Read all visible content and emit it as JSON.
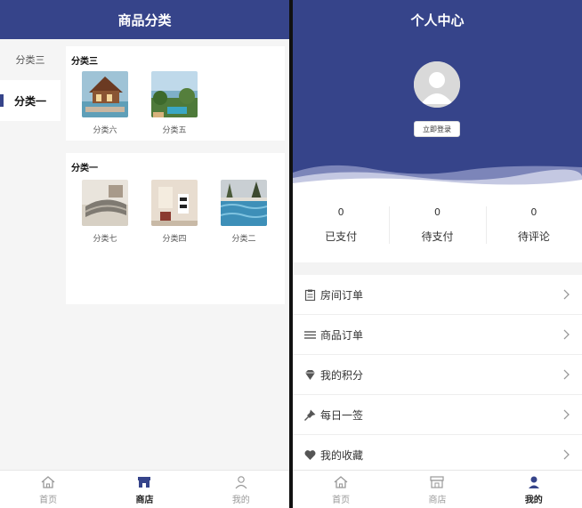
{
  "left": {
    "title": "商品分类",
    "categories": [
      {
        "label": "分类三",
        "active": false
      },
      {
        "label": "分类一",
        "active": true
      }
    ],
    "sections": [
      {
        "title": "分类三",
        "products": [
          {
            "label": "分类六"
          },
          {
            "label": "分类五"
          }
        ]
      },
      {
        "title": "分类一",
        "products": [
          {
            "label": "分类七"
          },
          {
            "label": "分类四"
          },
          {
            "label": "分类二"
          }
        ]
      }
    ],
    "tabs": [
      {
        "label": "首页",
        "icon": "home-icon",
        "active": false
      },
      {
        "label": "商店",
        "icon": "store-icon",
        "active": true
      },
      {
        "label": "我的",
        "icon": "user-icon",
        "active": false
      }
    ]
  },
  "right": {
    "title": "个人中心",
    "login_label": "立即登录",
    "stats": [
      {
        "value": "0",
        "label": "已支付"
      },
      {
        "value": "0",
        "label": "待支付"
      },
      {
        "value": "0",
        "label": "待评论"
      }
    ],
    "menu": [
      {
        "label": "房间订单",
        "icon": "clipboard-icon"
      },
      {
        "label": "商品订单",
        "icon": "list-icon"
      },
      {
        "label": "我的积分",
        "icon": "gem-icon"
      },
      {
        "label": "每日一签",
        "icon": "pin-icon"
      },
      {
        "label": "我的收藏",
        "icon": "heart-icon"
      }
    ],
    "tabs": [
      {
        "label": "首页",
        "icon": "home-icon",
        "active": false
      },
      {
        "label": "商店",
        "icon": "store-icon",
        "active": false
      },
      {
        "label": "我的",
        "icon": "user-icon",
        "active": true
      }
    ]
  },
  "colors": {
    "brand": "#36448a",
    "background": "#f5f5f5"
  }
}
